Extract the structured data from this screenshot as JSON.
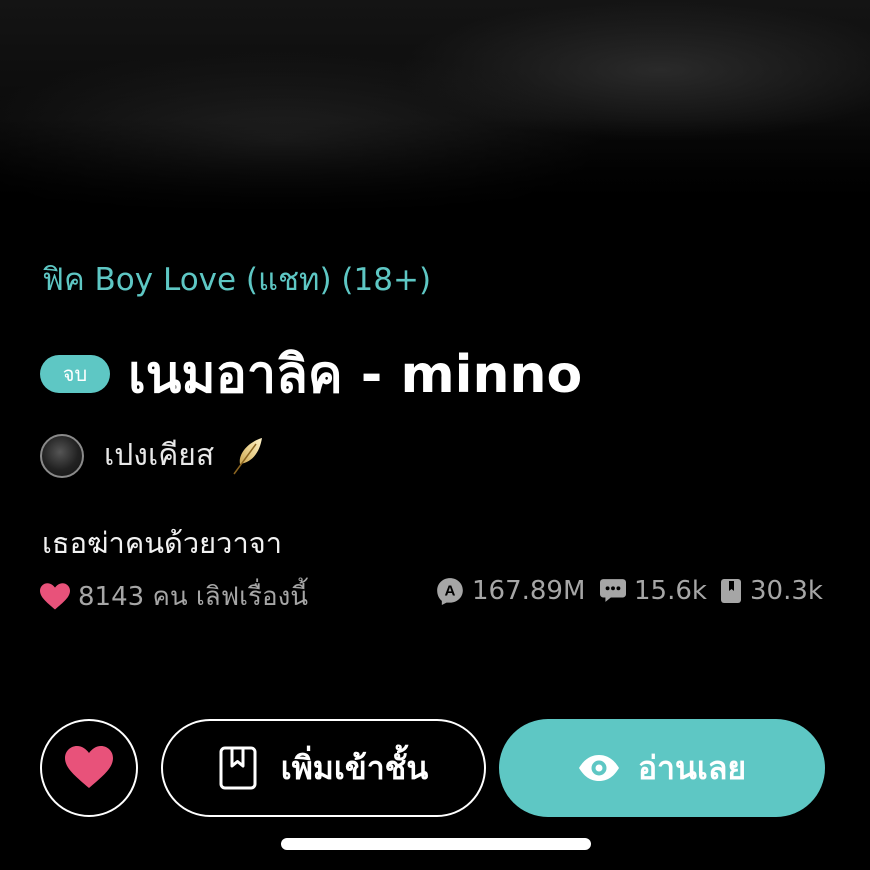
{
  "story": {
    "category": "ฟิค Boy Love (แชท) (18+)",
    "status_badge": "จบ",
    "title": "เนมอาลิค - minno",
    "author": "เปงเคียส",
    "tagline": "เธอฆ่าคนด้วยวาจา"
  },
  "stats": {
    "likes_count": "8143",
    "likes_suffix": "คน เลิฟเรื่องนี้",
    "views": "167.89M",
    "comments": "15.6k",
    "saves": "30.3k"
  },
  "actions": {
    "add_library_label": "เพิ่มเข้าชั้น",
    "read_label": "อ่านเลย"
  },
  "colors": {
    "accent": "#5ec7c4",
    "heart": "#e8527a",
    "muted": "#a6a6a6"
  },
  "icons": [
    "heart-icon",
    "eye-icon",
    "comment-icon",
    "bookmark-icon",
    "book-icon",
    "feather-icon"
  ]
}
